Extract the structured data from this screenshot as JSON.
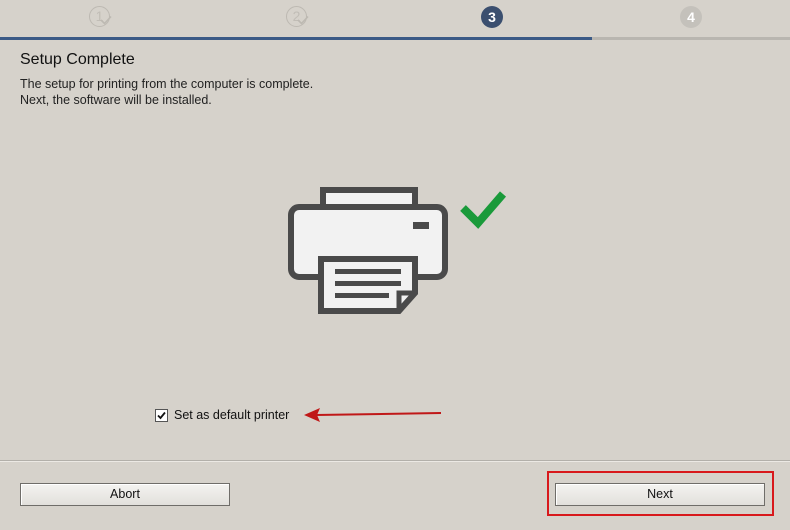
{
  "steps": [
    {
      "number": "1",
      "state": "done"
    },
    {
      "number": "2",
      "state": "done"
    },
    {
      "number": "3",
      "state": "current"
    },
    {
      "number": "4",
      "state": "future"
    }
  ],
  "heading": {
    "title": "Setup Complete",
    "line1": "The setup for printing from the computer is complete.",
    "line2": "Next, the software will be installed."
  },
  "illustration": {
    "icon": "printer-icon",
    "status_icon": "check-icon",
    "printer_color": "#4a4a4a",
    "check_color": "#1a9a3a"
  },
  "options": {
    "default_printer_label": "Set as default printer",
    "default_printer_checked": true
  },
  "annotation": {
    "arrow_color": "#c01818",
    "highlight_color": "#d8191c"
  },
  "footer": {
    "abort_label": "Abort",
    "next_label": "Next"
  }
}
